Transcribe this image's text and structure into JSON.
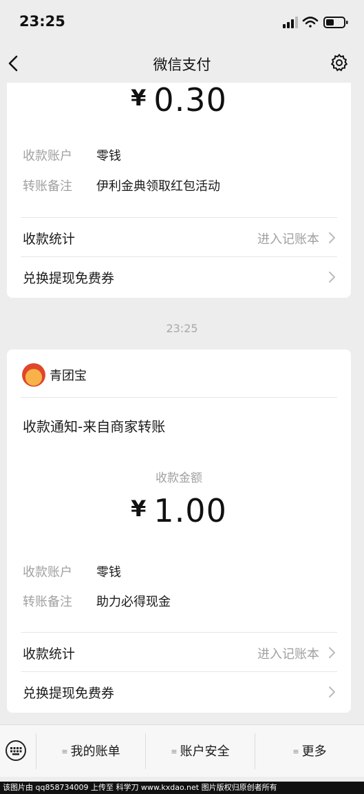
{
  "status": {
    "time": "23:25"
  },
  "nav": {
    "title": "微信支付"
  },
  "card1": {
    "amount_symbol": "¥",
    "amount_value": "0.30",
    "fields": [
      {
        "key": "收款账户",
        "value": "零钱"
      },
      {
        "key": "转账备注",
        "value": "伊利金典领取红包活动"
      }
    ],
    "stats_label": "收款统计",
    "stats_hint": "进入记账本",
    "coupon_label": "兑换提现免费券"
  },
  "separator_time": "23:25",
  "card2": {
    "merchant_name": "青团宝",
    "notice_title": "收款通知-来自商家转账",
    "amount_label": "收款金额",
    "amount_symbol": "¥",
    "amount_value": "1.00",
    "fields": [
      {
        "key": "收款账户",
        "value": "零钱"
      },
      {
        "key": "转账备注",
        "value": "助力必得现金"
      }
    ],
    "stats_label": "收款统计",
    "stats_hint": "进入记账本",
    "coupon_label": "兑换提现免费券"
  },
  "bottom_menu": {
    "items": [
      {
        "label": "我的账单"
      },
      {
        "label": "账户安全"
      },
      {
        "label": "更多"
      }
    ]
  },
  "watermark": "该图片由 qq858734009 上传至 科学刀 www.kxdao.net 图片版权归原创者所有",
  "colors": {
    "background": "#ededed",
    "card": "#ffffff",
    "muted_text": "#a0a0a0"
  }
}
